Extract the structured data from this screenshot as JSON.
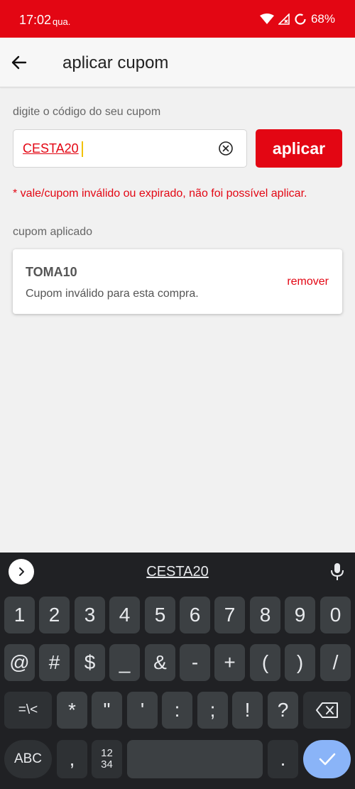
{
  "status_bar": {
    "time": "17:02",
    "day": "qua.",
    "battery": "68%",
    "colors": {
      "background": "#e30613"
    }
  },
  "app_bar": {
    "title": "aplicar cupom"
  },
  "coupon_form": {
    "label": "digite o código do seu cupom",
    "input_value": "CESTA20",
    "apply_label": "aplicar",
    "error_message": "* vale/cupom inválido ou expirado, não foi possível aplicar."
  },
  "applied_coupon": {
    "section_label": "cupom aplicado",
    "code": "TOMA10",
    "description": "Cupom inválido para esta compra.",
    "remove_label": "remover"
  },
  "keyboard": {
    "suggestion": "CESTA20",
    "row1": [
      "1",
      "2",
      "3",
      "4",
      "5",
      "6",
      "7",
      "8",
      "9",
      "0"
    ],
    "row2": [
      "@",
      "#",
      "$",
      "_",
      "&",
      "-",
      "+",
      "(",
      ")",
      "/"
    ],
    "row3": [
      "=\\<",
      "*",
      "\"",
      "'",
      ":",
      ";",
      "!",
      "?"
    ],
    "abc_label": "ABC",
    "comma": ",",
    "numpad_label": "12\n34",
    "period": "."
  },
  "colors": {
    "accent": "#e30613",
    "keyboard_bg": "#202124",
    "key_bg": "#3c4043",
    "enter_key": "#8ab4f8"
  }
}
